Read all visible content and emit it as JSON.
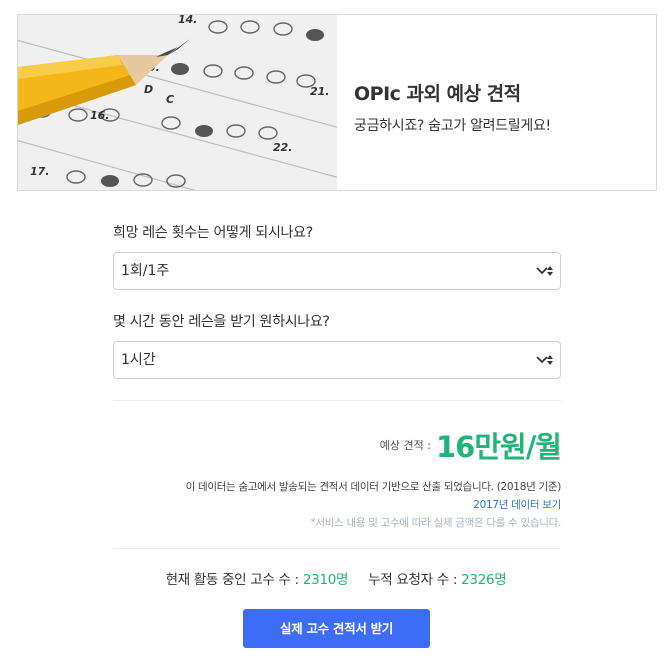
{
  "hero": {
    "title": "OPIc 과외 예상 견적",
    "subtitle": "궁금하시죠? 숨고가 알려드릴게요!",
    "image_icon": "answer-sheet-with-pencil"
  },
  "form": {
    "question1": {
      "label": "희망 레슨 횟수는 어떻게 되시나요?",
      "selected": "1회/1주"
    },
    "question2": {
      "label": "몇 시간 동안 레슨을 받기 원하시나요?",
      "selected": "1시간"
    }
  },
  "estimate": {
    "label": "예상 견적 :",
    "value": "16만원/월"
  },
  "notes": {
    "line1": "이 데이터는 숨고에서 발송되는 견적서 데이터 기반으로 산출 되었습니다. (2018년 기준)",
    "link": "2017년 데이터 보기",
    "disclaimer": "*서비스 내용 및 고수에 따라 실제 금액은 다를 수 있습니다."
  },
  "stats": {
    "active_label": "현재 활동 중인 고수 수 :",
    "active_value": "2310명",
    "requests_label": "누적 요청자 수 :",
    "requests_value": "2326명"
  },
  "cta": {
    "label": "실제 고수 견적서 받기"
  },
  "colors": {
    "accent_green": "#21b47a",
    "button_blue": "#3d6cf6",
    "link_blue": "#2b72d6"
  }
}
